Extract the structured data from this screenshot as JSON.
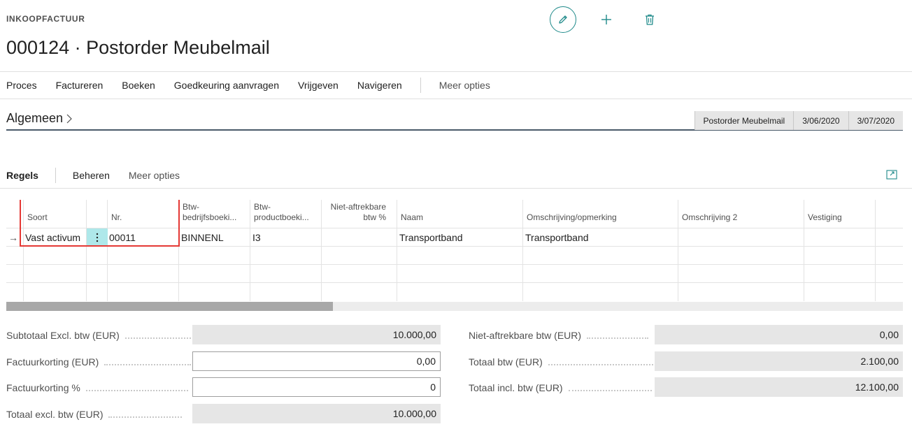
{
  "header": {
    "caption": "INKOOPFACTUUR",
    "title": "000124 · Postorder Meubelmail"
  },
  "top_actions": {
    "edit_icon": "pencil-icon",
    "new_icon": "plus-icon",
    "delete_icon": "trash-icon",
    "accent_color": "#1f8a8a"
  },
  "action_bar": {
    "items": [
      "Proces",
      "Factureren",
      "Boeken",
      "Goedkeuring aanvragen",
      "Vrijgeven",
      "Navigeren"
    ],
    "more": "Meer opties"
  },
  "general": {
    "title": "Algemeen",
    "summary": [
      "Postorder Meubelmail",
      "3/06/2020",
      "3/07/2020"
    ]
  },
  "lines": {
    "title": "Regels",
    "actions": [
      "Beheren",
      "Meer opties"
    ],
    "columns": {
      "type": "Soort",
      "no": "Nr.",
      "gen_bus_l1": "Btw-",
      "gen_bus_l2": "bedrijfsboeki...",
      "gen_prod_l1": "Btw-",
      "gen_prod_l2": "productboeki...",
      "nonded_l1": "Niet-aftrekbare",
      "nonded_l2": "btw %",
      "name": "Naam",
      "description": "Omschrijving/opmerking",
      "description2": "Omschrijving 2",
      "location": "Vestiging"
    },
    "rows": [
      {
        "type": "Vast activum",
        "no": "00011",
        "gen_bus": "BINNENL",
        "gen_prod": "I3",
        "nonded": "",
        "name": "Transportband",
        "description": "Transportband",
        "description2": "",
        "location": ""
      }
    ],
    "highlight_color": "#e53935"
  },
  "totals": {
    "subtotal_label": "Subtotaal Excl. btw (EUR)",
    "subtotal_value": "10.000,00",
    "inv_discount_label": "Factuurkorting (EUR)",
    "inv_discount_value": "0,00",
    "inv_discount_pct_label": "Factuurkorting %",
    "inv_discount_pct_value": "0",
    "total_excl_label": "Totaal excl. btw (EUR)",
    "total_excl_value": "10.000,00",
    "nonded_label": "Niet-aftrekbare btw (EUR)",
    "nonded_value": "0,00",
    "total_vat_label": "Totaal btw (EUR)",
    "total_vat_value": "2.100,00",
    "total_incl_label": "Totaal incl. btw (EUR)",
    "total_incl_value": "12.100,00"
  }
}
